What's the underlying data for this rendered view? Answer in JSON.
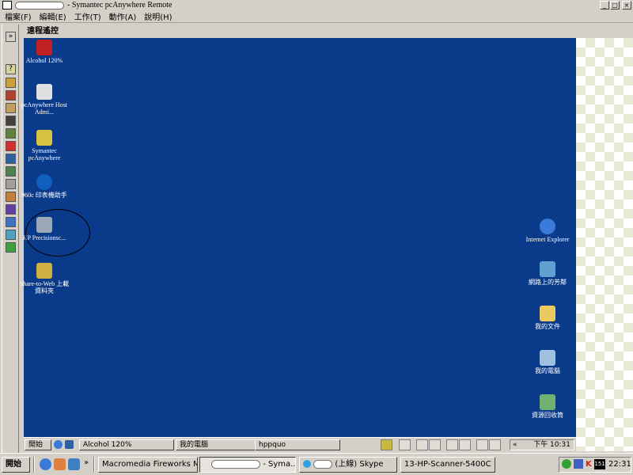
{
  "window": {
    "title": "- Symantec pcAnywhere Remote",
    "min_glyph": "_",
    "max_glyph": "□",
    "close_glyph": "×"
  },
  "menu": [
    {
      "label": "檔案(F)"
    },
    {
      "label": "編輯(E)"
    },
    {
      "label": "工作(T)"
    },
    {
      "label": "動作(A)"
    },
    {
      "label": "說明(H)"
    }
  ],
  "left_toolbar": {
    "expand_glyph": "»",
    "help_glyph": "?"
  },
  "remote": {
    "panel_title": "遠程遙控",
    "desktop_color": "#0a3a8a",
    "left_icons": [
      {
        "label": "Alcohol 120%",
        "icon": "alcohol-icon",
        "color": "#c02020"
      },
      {
        "label": "pcAnywhere Host Admi...",
        "icon": "pcanywhere-host-icon",
        "color": "#e0e0e0"
      },
      {
        "label": "Symantec pcAnywhere",
        "icon": "pcanywhere-icon",
        "color": "#d8c040"
      },
      {
        "label": "960c 印表機助手",
        "icon": "hp-printer-icon",
        "color": "#1060c0"
      },
      {
        "label": "HP Precisionsc...",
        "icon": "hp-scanner-icon",
        "color": "#9aa8b8"
      },
      {
        "label": "Share-to-Web 上載資料夾",
        "icon": "share-to-web-icon",
        "color": "#d0b040"
      }
    ],
    "right_icons": [
      {
        "label": "Internet Explorer",
        "icon": "ie-icon",
        "color": "#3a7ad8"
      },
      {
        "label": "網路上的芳鄰",
        "icon": "network-icon",
        "color": "#60a0d0"
      },
      {
        "label": "我的文件",
        "icon": "my-documents-icon",
        "color": "#e8c860"
      },
      {
        "label": "我的電腦",
        "icon": "my-computer-icon",
        "color": "#a0c0e0"
      },
      {
        "label": "資源回收筒",
        "icon": "recycle-bin-icon",
        "color": "#70b070"
      }
    ],
    "taskbar": {
      "start": "開始",
      "buttons": [
        {
          "label": "Alcohol 120%"
        },
        {
          "label": "我的電腦"
        },
        {
          "label": "hppquo"
        }
      ],
      "tray_arrows": "«",
      "clock": "下午 10:31"
    }
  },
  "local_taskbar": {
    "start": "開始",
    "quick_more": "»",
    "buttons": [
      {
        "label": "Macromedia Fireworks M..."
      },
      {
        "label": "- Syma..."
      },
      {
        "label": "(上線) Skype"
      },
      {
        "label": "13-HP-Scanner-5400C"
      }
    ],
    "tray_badge": "151",
    "clock": "22:31"
  }
}
